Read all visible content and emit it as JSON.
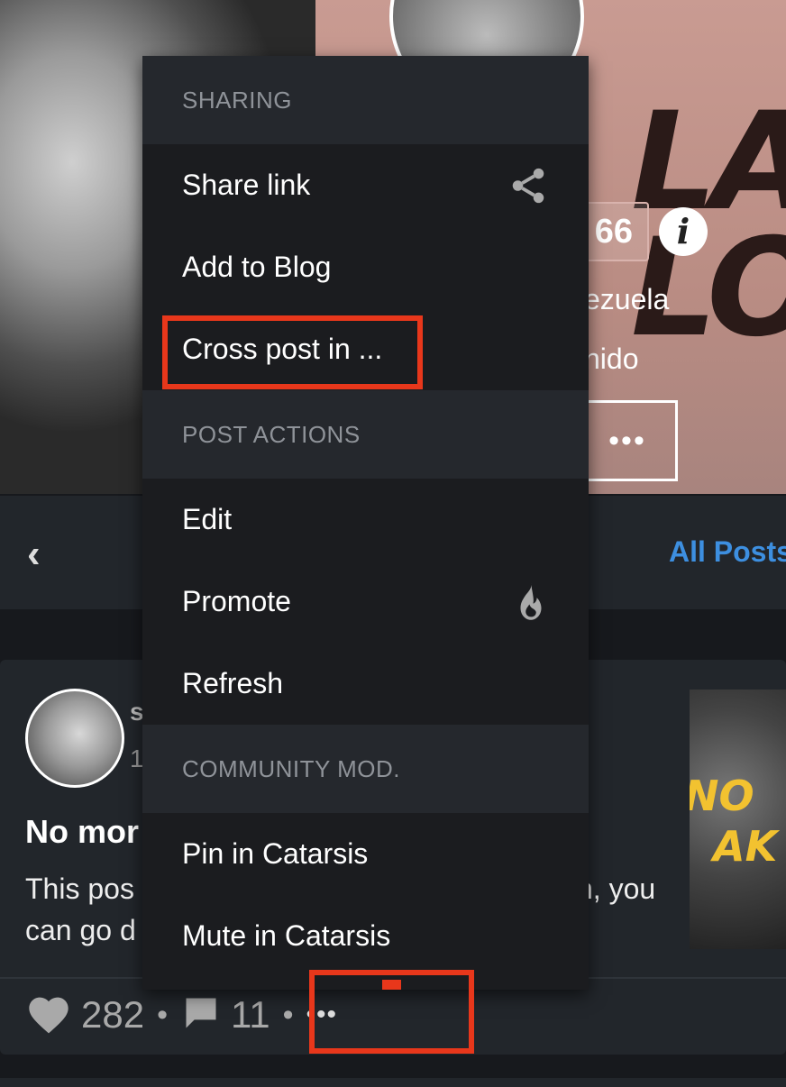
{
  "profile": {
    "stat_value": "66",
    "info_glyph": "i",
    "location_fragment": "ezuela",
    "title_fragment": "nido",
    "more_glyph": "•••",
    "banner_letters": "LA\nLO"
  },
  "nav": {
    "back_glyph": "‹",
    "all_posts_label": "All Posts"
  },
  "post": {
    "author_fragment": "s",
    "time_fragment": "1",
    "title_fragment": "No mor",
    "excerpt_line1_start": "This pos",
    "excerpt_line1_end": "n, you",
    "excerpt_line2_start": "can go d",
    "thumb_text": "NO \n  AK",
    "likes": "282",
    "comments": "11",
    "separator": "•",
    "more_glyph": "•••"
  },
  "menu": {
    "sections": [
      {
        "header": "SHARING",
        "items": [
          {
            "label": "Share link",
            "icon": "share-icon"
          },
          {
            "label": "Add to Blog",
            "icon": ""
          },
          {
            "label": "Cross post in ...",
            "icon": ""
          }
        ]
      },
      {
        "header": "POST ACTIONS",
        "items": [
          {
            "label": "Edit",
            "icon": ""
          },
          {
            "label": "Promote",
            "icon": "fire-icon"
          },
          {
            "label": "Refresh",
            "icon": ""
          }
        ]
      },
      {
        "header": "COMMUNITY MOD.",
        "items": [
          {
            "label": "Pin in Catarsis",
            "icon": ""
          },
          {
            "label": "Mute in Catarsis",
            "icon": ""
          }
        ]
      }
    ]
  },
  "colors": {
    "highlight": "#e8371b",
    "link": "#3d8fe0",
    "menu_bg": "#1b1c1f",
    "section_bg": "#25282d"
  }
}
